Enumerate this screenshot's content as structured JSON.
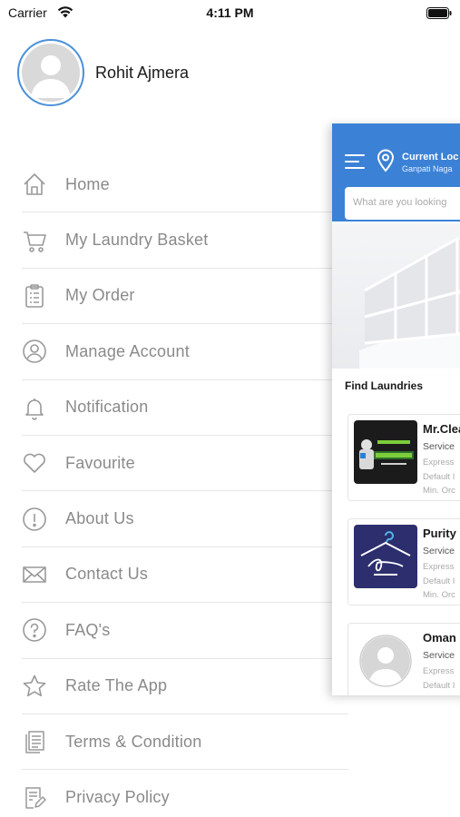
{
  "status_bar": {
    "carrier": "Carrier",
    "time": "4:11 PM"
  },
  "profile": {
    "name": "Rohit Ajmera"
  },
  "menu": {
    "items": [
      {
        "label": "Home",
        "icon": "home-icon"
      },
      {
        "label": "My Laundry Basket",
        "icon": "cart-icon"
      },
      {
        "label": "My Order",
        "icon": "clipboard-list-icon"
      },
      {
        "label": "Manage Account",
        "icon": "user-circle-icon"
      },
      {
        "label": "Notification",
        "icon": "bell-icon"
      },
      {
        "label": "Favourite",
        "icon": "heart-icon"
      },
      {
        "label": "About Us",
        "icon": "info-circle-icon"
      },
      {
        "label": "Contact Us",
        "icon": "envelope-icon"
      },
      {
        "label": "FAQ's",
        "icon": "question-circle-icon"
      },
      {
        "label": "Rate The App",
        "icon": "star-icon"
      },
      {
        "label": "Terms & Condition",
        "icon": "documents-icon"
      },
      {
        "label": "Privacy Policy",
        "icon": "document-edit-icon"
      }
    ]
  },
  "preview": {
    "location_title": "Current Loc",
    "location_subtitle": "Ganpati Naga",
    "search_placeholder": "What are you looking",
    "section_title": "Find Laundries",
    "laundries": [
      {
        "name": "Mr.Clea",
        "line1": "Service",
        "line2": "Express",
        "line3": "Default I",
        "line4": "Min. Orc"
      },
      {
        "name": "Purity",
        "line1": "Service",
        "line2": "Express",
        "line3": "Default I",
        "line4": "Min. Orc"
      },
      {
        "name": "Oman",
        "line1": "Service",
        "line2": "Express",
        "line3": "Default I"
      }
    ]
  },
  "colors": {
    "accent": "#3b82d6",
    "avatar_ring": "#4a90d9",
    "menu_text": "#8a8a8a"
  }
}
